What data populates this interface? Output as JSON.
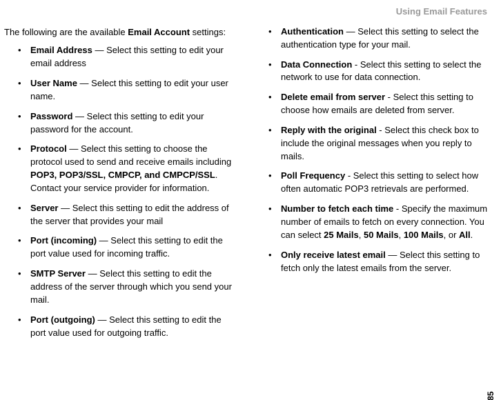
{
  "header": "Using Email Features",
  "page_number": "85",
  "intro_pre": "The following are the available ",
  "intro_bold": "Email Account",
  "intro_post": " settings:",
  "left_items": [
    {
      "term": "Email Address",
      "sep": " — ",
      "text": "Select this setting to edit your email address"
    },
    {
      "term": "User Name",
      "sep": " — ",
      "text": "Select this setting to edit your user name."
    },
    {
      "term": "Password",
      "sep": " — ",
      "text": "Select this setting to edit your password for the account."
    },
    {
      "term": "Protocol",
      "sep": " — ",
      "pre": "Select this setting to choose the protocol used to send and receive emails including ",
      "mid_bold": "POP3, POP3/SSL, CMPCP, and CMPCP/SSL",
      "post": ". Contact your service provider for information."
    },
    {
      "term": "Server",
      "sep": " — ",
      "text": "Select this setting to edit the address of the server that provides your mail"
    },
    {
      "term": "Port (incoming)",
      "sep": " — ",
      "text": "Select this setting to edit the port value used for incoming traffic."
    },
    {
      "term": "SMTP Server",
      "sep": " — ",
      "text": "Select this setting to edit the address of the server through which you send your mail."
    },
    {
      "term": "Port (outgoing)",
      "sep": " — ",
      "text": "Select this setting to edit the port value used for outgoing traffic."
    }
  ],
  "right_items": [
    {
      "term": "Authentication",
      "sep": " — ",
      "text": "Select this setting to select the authentication type for your mail."
    },
    {
      "term": "Data Connection",
      "sep": " - ",
      "text": "Select this setting to select the network to use for data connection."
    },
    {
      "term": "Delete email from server",
      "sep": " - ",
      "text": "Select this setting to choose how emails are deleted from server."
    },
    {
      "term": "Reply with the original",
      "sep": " - ",
      "text": "Select this check box to include the original messages when you reply to mails."
    },
    {
      "term": "Poll Frequency",
      "sep": " - ",
      "text": "Select this setting to select how often automatic POP3 retrievals are performed."
    },
    {
      "term": "Number to fetch each time",
      "sep": " - ",
      "segments": [
        {
          "b": false,
          "t": "Specify the maximum number of emails to fetch on every connection. You can select "
        },
        {
          "b": true,
          "t": "25 Mails"
        },
        {
          "b": false,
          "t": ", "
        },
        {
          "b": true,
          "t": "50 Mails"
        },
        {
          "b": false,
          "t": ", "
        },
        {
          "b": true,
          "t": "100 Mails"
        },
        {
          "b": false,
          "t": ", or "
        },
        {
          "b": true,
          "t": "All"
        },
        {
          "b": false,
          "t": "."
        }
      ]
    },
    {
      "term": "Only receive latest email",
      "sep": " — ",
      "text": "Select this setting to fetch only the latest emails from the server."
    }
  ]
}
